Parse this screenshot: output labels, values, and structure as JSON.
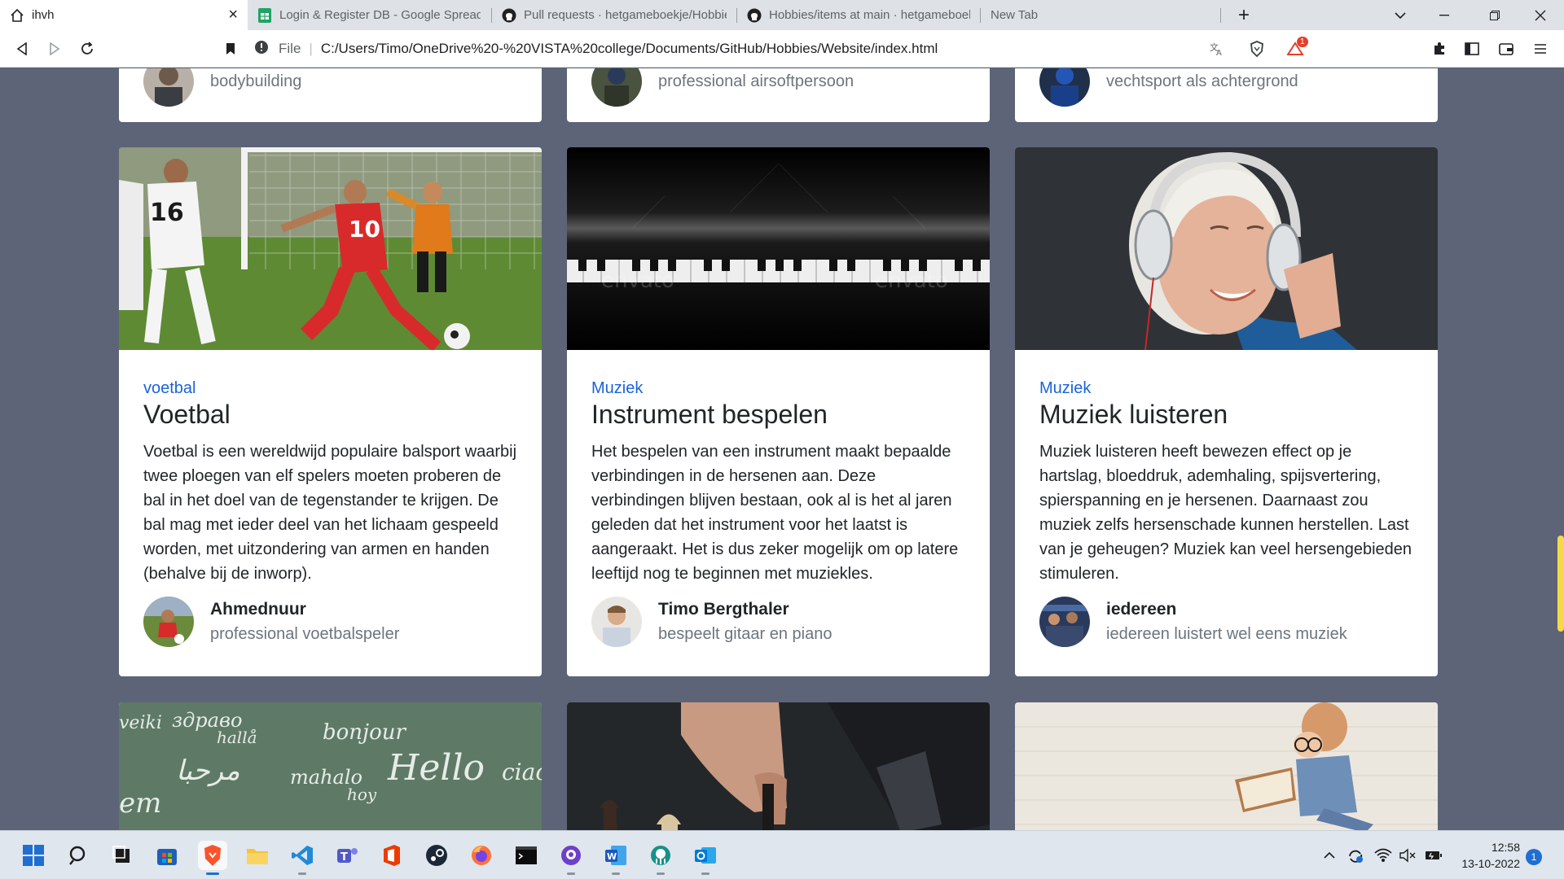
{
  "browser": {
    "tabs": [
      {
        "label": "ihvh",
        "active": true
      },
      {
        "label": "Login & Register DB - Google Spreads"
      },
      {
        "label": "Pull requests · hetgameboekje/Hobbie"
      },
      {
        "label": "Hobbies/items at main · hetgameboek"
      },
      {
        "label": "New Tab"
      }
    ],
    "new_tab": "+",
    "file_label": "File",
    "url": "C:/Users/Timo/OneDrive%20-%20VISTA%20college/Documents/GitHub/Hobbies/Website/index.html",
    "shield_badge": "1"
  },
  "top_cards": [
    {
      "role": "bodybuilding"
    },
    {
      "role": "professional airsoftpersoon"
    },
    {
      "role": "vechtsport als achtergrond"
    }
  ],
  "cards": [
    {
      "category": "voetbal",
      "title": "Voetbal",
      "description": "Voetbal is een wereldwijd populaire balsport waarbij twee ploegen van elf spelers moeten proberen de bal in het doel van de tegenstander te krijgen. De bal mag met ieder deel van het lichaam gespeeld worden, met uitzondering van armen en handen (behalve bij de inworp).",
      "author": "Ahmednuur",
      "role": "professional voetbalspeler"
    },
    {
      "category": "Muziek",
      "title": "Instrument bespelen",
      "description": "Het bespelen van een instrument maakt bepaalde verbindingen in de hersenen aan. Deze verbindingen blijven bestaan, ook al is het al jaren geleden dat het instrument voor het laatst is aangeraakt. Het is dus zeker mogelijk om op latere leeftijd nog te beginnen met muziekles.",
      "author": "Timo Bergthaler",
      "role": "bespeelt gitaar en piano"
    },
    {
      "category": "Muziek",
      "title": "Muziek luisteren",
      "description": "Muziek luisteren heeft bewezen effect op je hartslag, bloeddruk, ademhaling, spijsvertering, spierspanning en je hersenen. Daarnaast zou muziek zelfs hersenschade kunnen herstellen. Last van je geheugen? Muziek kan veel hersengebieden stimuleren.",
      "author": "iedereen",
      "role": "iedereen luistert wel eens muziek"
    }
  ],
  "chalkboard_words": [
    "здраво",
    "hallå",
    "bonjour",
    "Hello",
    "مرحبا",
    "mahalo",
    "hoy",
    "ciao",
    "em",
    "veiki"
  ],
  "image_watermark": "envato",
  "taskbar": {
    "time": "12:58",
    "date": "13-10-2022",
    "notifications": "1"
  }
}
